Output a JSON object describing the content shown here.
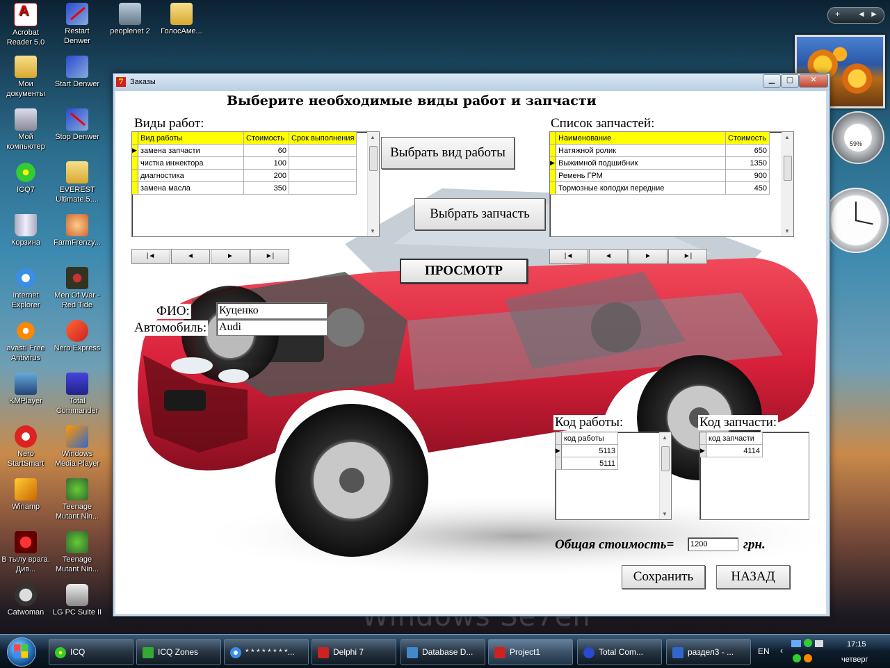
{
  "desktop": {
    "icons": [
      {
        "label": "Acrobat Reader 5.0"
      },
      {
        "label": "Restart Denwer"
      },
      {
        "label": "peoplenet 2"
      },
      {
        "label": "ГолосАме..."
      },
      {
        "label": "Мои документы"
      },
      {
        "label": "Start Denwer"
      },
      {
        "label": "Мой компьютер"
      },
      {
        "label": "Stop Denwer"
      },
      {
        "label": "ICQ7"
      },
      {
        "label": "EVEREST Ultimate.5...."
      },
      {
        "label": "Корзина"
      },
      {
        "label": "FarmFrenzy..."
      },
      {
        "label": "Internet Explorer"
      },
      {
        "label": "Men Of War - Red Tide"
      },
      {
        "label": "avast! Free Antivirus"
      },
      {
        "label": "Nero Express"
      },
      {
        "label": "KMPlayer"
      },
      {
        "label": "Total Commander"
      },
      {
        "label": "Nero StartSmart"
      },
      {
        "label": "Windows Media Player"
      },
      {
        "label": "Winamp"
      },
      {
        "label": "Teenage Mutant Nin..."
      },
      {
        "label": "В тылу врага. Див..."
      },
      {
        "label": "Teenage Mutant Nin..."
      },
      {
        "label": "Catwoman"
      },
      {
        "label": "LG PC Suite II"
      }
    ],
    "gadget_percent": "59%",
    "watermark": "Windows Se7en"
  },
  "window": {
    "title": "Заказы",
    "heading": "Выберите необходимые виды работ и запчасти",
    "works_label": "Виды работ:",
    "works_grid": {
      "columns": [
        "Вид работы",
        "Стоимость",
        "Срок выполнения"
      ],
      "rows": [
        {
          "name": "замена запчасти",
          "cost": "60",
          "term": ""
        },
        {
          "name": "чистка инжектора",
          "cost": "100",
          "term": ""
        },
        {
          "name": "диагностика",
          "cost": "200",
          "term": ""
        },
        {
          "name": "замена масла",
          "cost": "350",
          "term": ""
        }
      ]
    },
    "parts_label": "Список запчастей:",
    "parts_grid": {
      "columns": [
        "Наименование",
        "Стоимость"
      ],
      "rows": [
        {
          "name": "Натяжной ролик",
          "cost": "650"
        },
        {
          "name": "Выжимной подшибник",
          "cost": "1350"
        },
        {
          "name": "Ремень ГРМ",
          "cost": "900"
        },
        {
          "name": "Тормозные колодки передние",
          "cost": "450"
        }
      ]
    },
    "nav_buttons": [
      "|◄",
      "◄",
      "►",
      "►|"
    ],
    "btn_select_work": "Выбрать вид работы",
    "btn_select_part": "Выбрать запчасть",
    "btn_view": "ПРОСМОТР",
    "fio_label": "ФИО:",
    "fio_value": "Куценко",
    "car_label": "Автомобиль:",
    "car_value": "Audi",
    "work_code_label": "Код работы:",
    "work_code_grid": {
      "column": "код работы",
      "rows": [
        "5113",
        "5111"
      ]
    },
    "part_code_label": "Код запчасти:",
    "part_code_grid": {
      "column": "код запчасти",
      "rows": [
        "4114"
      ]
    },
    "total_label": "Общая стоимость=",
    "total_value": "1200",
    "currency": "грн.",
    "btn_save": "Сохранить",
    "btn_back": "НАЗАД"
  },
  "taskbar": {
    "items": [
      {
        "label": "ICQ"
      },
      {
        "label": "ICQ Zones"
      },
      {
        "label": "* * * * * * * *..."
      },
      {
        "label": "Delphi 7"
      },
      {
        "label": "Database D..."
      },
      {
        "label": "Project1"
      },
      {
        "label": "Total Com..."
      },
      {
        "label": "раздел3 - ..."
      }
    ],
    "lang": "EN",
    "time": "17:15",
    "day": "четверг"
  },
  "colors": {
    "car": "#d8203a",
    "grid_header": "#ffff00",
    "title_bar": "#c9d9e8"
  }
}
